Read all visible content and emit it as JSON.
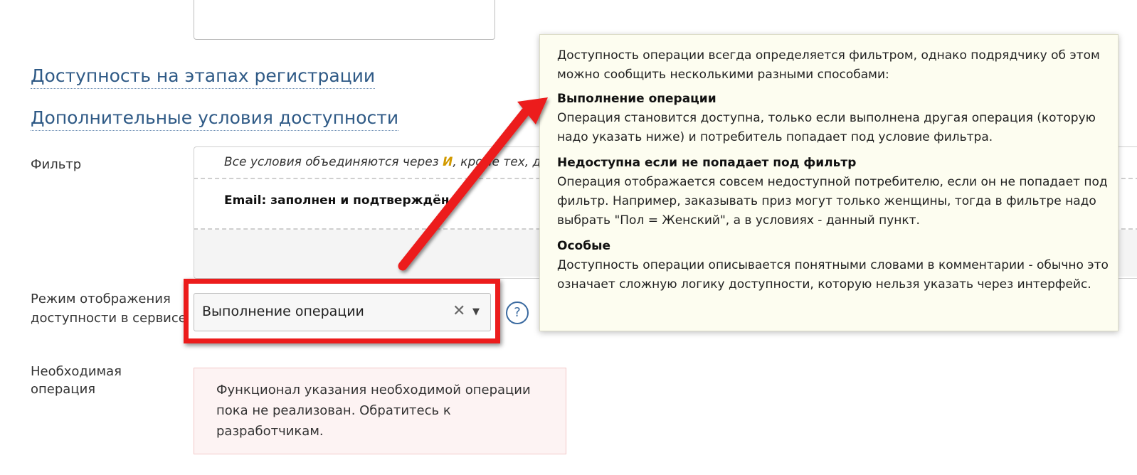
{
  "sections": {
    "availability_stages": "Доступность на этапах регистрации",
    "extra_conditions": "Дополнительные условия доступности"
  },
  "filter": {
    "label": "Фильтр",
    "note_prefix": "Все условия объединяются через ",
    "note_and": "И",
    "note_suffix": ", кроме тех, д",
    "items": [
      "Email: заполнен и подтверждён"
    ]
  },
  "display_mode": {
    "label": "Режим отображения доступности в сервисе",
    "selected": "Выполнение операции",
    "clear_glyph": "✕",
    "caret_glyph": "▼",
    "help_glyph": "?"
  },
  "required_operation": {
    "label": "Необходимая операция",
    "message": "Функционал указания необходимой операции пока не реализован. Обратитесь к разработчикам."
  },
  "tooltip": {
    "intro": "Доступность операции всегда определяется фильтром, однако подрядчику об этом можно сообщить несколькими разными способами:",
    "options": [
      {
        "title": "Выполнение операции",
        "text": "Операция становится доступна, только если выполнена другая операция (которую надо указать ниже) и потребитель попадает под условие фильтра."
      },
      {
        "title": "Недоступна если не попадает под фильтр",
        "text": "Операция отображается совсем недоступной потребителю, если он не попадает под фильтр. Например, заказывать приз могут только женщины, тогда в фильтре надо выбрать \"Пол = Женский\", а в условиях - данный пункт."
      },
      {
        "title": "Особые",
        "text": "Доступность операции описывается понятными словами в комментарии - обычно это означает сложную логику доступности, которую нельзя указать через интерфейс."
      }
    ]
  },
  "colors": {
    "heading": "#2f5a86",
    "annotation_red": "#ec1c1c",
    "tooltip_bg": "#fdfdf0",
    "error_bg": "#fdf3f3",
    "filter_and": "#d29a00"
  }
}
